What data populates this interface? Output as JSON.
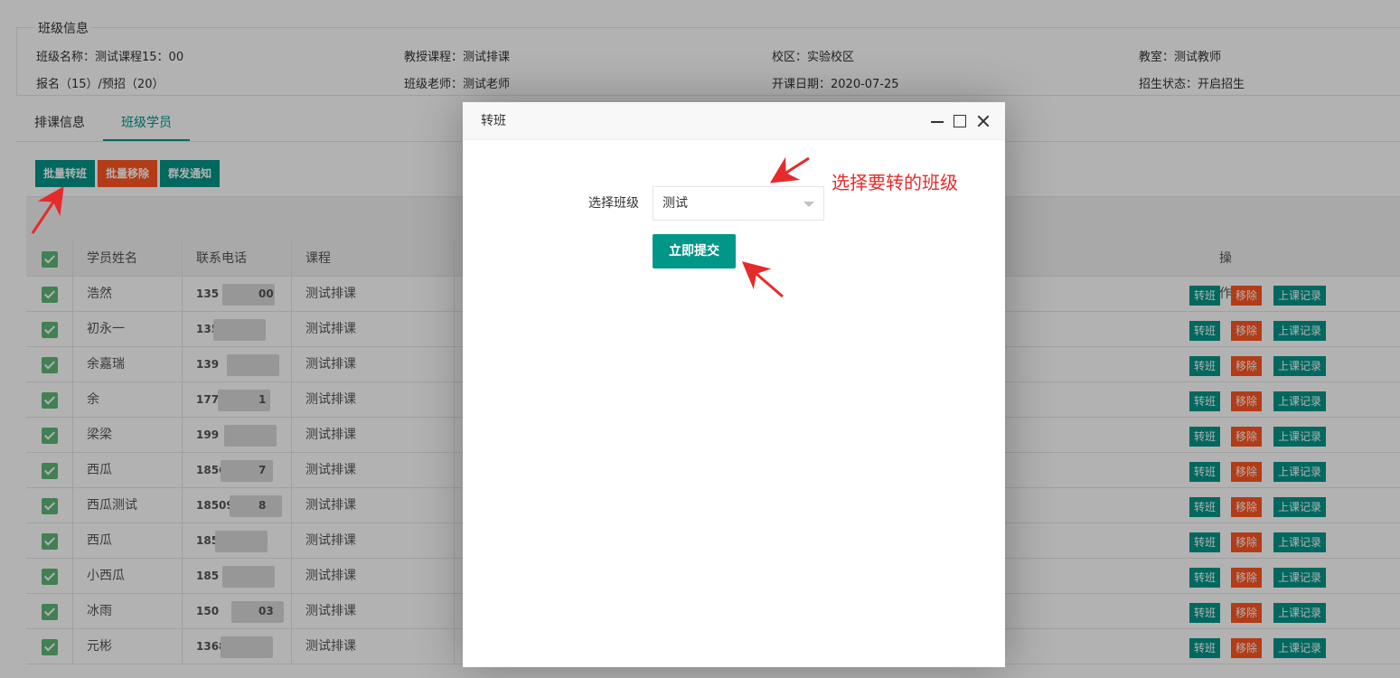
{
  "class_info": {
    "legend": "班级信息",
    "class_name": "班级名称：测试课程15：00",
    "course": "教授课程：测试排课",
    "campus": "校区：实验校区",
    "classroom": "教室：测试教师",
    "enrollment": "报名（15）/预招（20）",
    "teacher": "班级老师：测试老师",
    "start_date": "开课日期：2020-07-25",
    "status": "招生状态：开启招生"
  },
  "tabs": [
    "排课信息",
    "班级学员"
  ],
  "toolbar": {
    "batch_transfer": "批量转班",
    "batch_remove": "批量移除",
    "broadcast": "群发通知"
  },
  "table": {
    "headers": {
      "name": "学员姓名",
      "phone": "联系电话",
      "course": "课程",
      "op": "操作"
    },
    "rows": [
      {
        "name": "浩然",
        "phone_a": "135",
        "phone_b": "00",
        "course": "测试排课"
      },
      {
        "name": "初永一",
        "phone_a": "1358",
        "phone_b": "",
        "course": "测试排课"
      },
      {
        "name": "余嘉瑞",
        "phone_a": "139",
        "phone_b": "",
        "course": "测试排课"
      },
      {
        "name": "余",
        "phone_a": "1778",
        "phone_b": "1",
        "course": "测试排课"
      },
      {
        "name": "梁梁",
        "phone_a": "199",
        "phone_b": "",
        "course": "测试排课"
      },
      {
        "name": "西瓜",
        "phone_a": "1856",
        "phone_b": "7",
        "course": "测试排课"
      },
      {
        "name": "西瓜测试",
        "phone_a": "18509",
        "phone_b": "8",
        "course": "测试排课"
      },
      {
        "name": "西瓜",
        "phone_a": "185",
        "phone_b": "",
        "course": "测试排课"
      },
      {
        "name": "小西瓜",
        "phone_a": "185",
        "phone_b": "",
        "course": "测试排课"
      },
      {
        "name": "冰雨",
        "phone_a": "150",
        "phone_b": "03",
        "course": "测试排课"
      },
      {
        "name": "元彬",
        "phone_a": "1368",
        "phone_b": "",
        "course": "测试排课"
      }
    ],
    "row_actions": {
      "transfer": "转班",
      "remove": "移除",
      "records": "上课记录"
    }
  },
  "modal": {
    "title": "转班",
    "field_label": "选择班级",
    "selected_class": "测试",
    "submit_label": "立即提交"
  },
  "annotation": {
    "text": "选择要转的班级",
    "color": "#E52B2B"
  },
  "colors": {
    "teal": "#009688",
    "orange": "#FF5722",
    "check_green": "#5FB878"
  }
}
